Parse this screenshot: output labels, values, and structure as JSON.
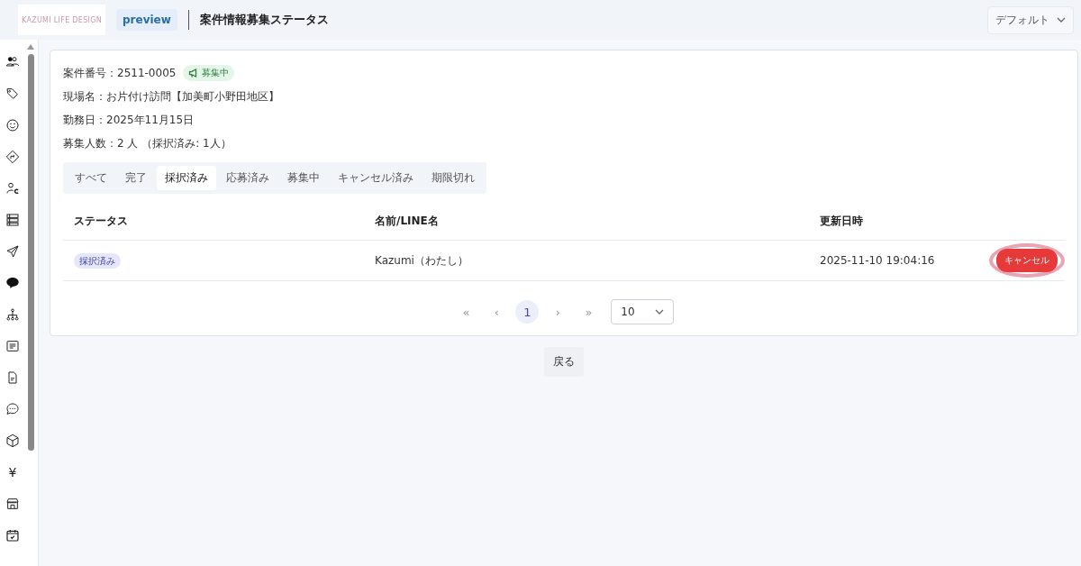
{
  "header": {
    "logo_text": "KAZUMI LIFE DESIGN",
    "env_badge": "preview",
    "title": "案件情報募集ステータス",
    "view_select": "デフォルト"
  },
  "sidebar": {
    "icons": [
      {
        "kind": "users"
      },
      {
        "kind": "tag"
      },
      {
        "kind": "smile"
      },
      {
        "kind": "sign"
      },
      {
        "kind": "userc"
      },
      {
        "kind": "stack"
      },
      {
        "kind": "send"
      },
      {
        "kind": "bubble"
      },
      {
        "kind": "tree"
      },
      {
        "kind": "lines"
      },
      {
        "kind": "file"
      },
      {
        "kind": "dots"
      },
      {
        "kind": "cube"
      },
      {
        "kind": "yen",
        "text": "¥"
      },
      {
        "kind": "store"
      },
      {
        "kind": "calendar"
      }
    ]
  },
  "info": [
    {
      "label": "案件番号：",
      "value": "2511-0005",
      "badge": "募集中"
    },
    {
      "label": "現場名：",
      "value": "お片付け訪問【加美町小野田地区】"
    },
    {
      "label": "勤務日：",
      "value": "2025年11月15日"
    },
    {
      "label": "募集人数：",
      "value": "2 人 （採択済み: 1人）"
    }
  ],
  "tabs": [
    {
      "label": "すべて",
      "selected": false
    },
    {
      "label": "完了",
      "selected": false
    },
    {
      "label": "採択済み",
      "selected": true
    },
    {
      "label": "応募済み",
      "selected": false
    },
    {
      "label": "募集中",
      "selected": false
    },
    {
      "label": "キャンセル済み",
      "selected": false
    },
    {
      "label": "期限切れ",
      "selected": false
    }
  ],
  "table": {
    "columns": [
      "ステータス",
      "名前/LINE名",
      "更新日時"
    ],
    "rows": [
      {
        "status": "採択済み",
        "name": "Kazumi（わたし）",
        "updated": "2025-11-10 19:04:16",
        "action": "キャンセル",
        "highlighted": true
      }
    ]
  },
  "pagination": {
    "first": "«",
    "prev": "‹",
    "pages": [
      {
        "label": "1",
        "selected": true
      }
    ],
    "next": "›",
    "last": "»",
    "page_size": "10"
  },
  "back_button": "戻る"
}
